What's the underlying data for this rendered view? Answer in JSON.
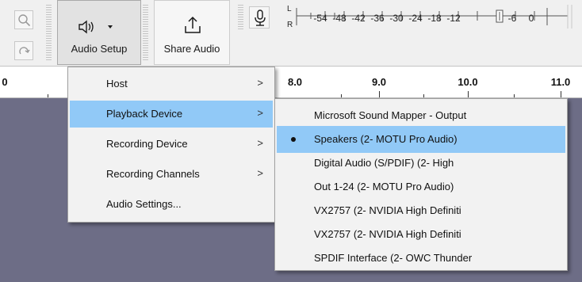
{
  "toolbar": {
    "audio_setup_label": "Audio Setup",
    "audio_setup_icon": "speaker-icon",
    "share_audio_label": "Share Audio",
    "share_audio_icon": "share-upload-icon",
    "zoom_icon": "zoom-in-icon",
    "redo_icon": "redo-icon",
    "mic_icon": "microphone-icon"
  },
  "meter": {
    "channel_top": "L",
    "channel_bottom": "R",
    "ticks": [
      "-54",
      "-48",
      "-42",
      "-36",
      "-30",
      "-24",
      "-18",
      "-12",
      "-6",
      "0"
    ]
  },
  "ruler": {
    "labels": [
      "0",
      "8.0",
      "9.0",
      "10.0",
      "11.0"
    ]
  },
  "menu": {
    "items": [
      {
        "label": "Host",
        "submenu": true
      },
      {
        "label": "Playback Device",
        "submenu": true,
        "highlighted": true
      },
      {
        "label": "Recording Device",
        "submenu": true
      },
      {
        "label": "Recording Channels",
        "submenu": true
      },
      {
        "label": "Audio Settings...",
        "submenu": false
      }
    ],
    "arrow": ">"
  },
  "submenu": {
    "items": [
      {
        "label": "Microsoft Sound Mapper - Output"
      },
      {
        "label": "Speakers (2- MOTU Pro Audio)",
        "selected": true
      },
      {
        "label": "Digital Audio (S/PDIF) (2- High"
      },
      {
        "label": "Out 1-24 (2- MOTU Pro Audio)"
      },
      {
        "label": "VX2757 (2- NVIDIA High Definiti"
      },
      {
        "label": "VX2757 (2- NVIDIA High Definiti"
      },
      {
        "label": "SPDIF Interface (2- OWC Thunder"
      }
    ]
  },
  "colors": {
    "highlight": "#91c9f7",
    "track_background": "#6d6d86",
    "toolbar_background": "#f0f0f0"
  }
}
